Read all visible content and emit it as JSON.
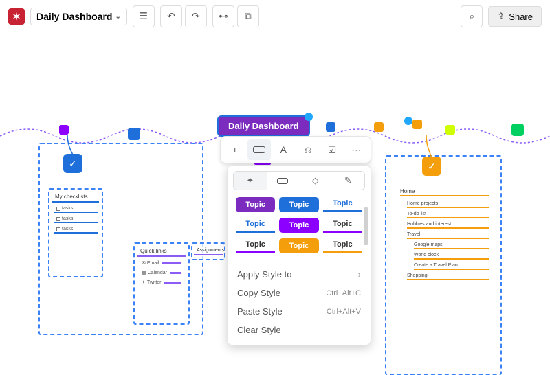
{
  "header": {
    "title": "Daily Dashboard",
    "share_label": "Share"
  },
  "root_node": "Daily Dashboard",
  "checklists": {
    "title": "My checklists",
    "items": [
      "tasks",
      "tasks",
      "tasks"
    ]
  },
  "quick_links": {
    "title": "Quick links",
    "items": [
      "Email",
      "Calendar",
      "Twitter"
    ]
  },
  "assignments": {
    "title": "Assignments"
  },
  "home": {
    "title": "Home",
    "items": [
      {
        "label": "Home projects",
        "sub": []
      },
      {
        "label": "To-do list",
        "sub": []
      },
      {
        "label": "Hobbies and interest",
        "sub": []
      },
      {
        "label": "Travel",
        "sub": [
          "Google maps",
          "World clock",
          "Create a Travel  Plan"
        ]
      },
      {
        "label": "Shopping",
        "sub": []
      }
    ]
  },
  "style_panel": {
    "swatches": [
      "Topic",
      "Topic",
      "Topic",
      "Topic",
      "Topic",
      "Topic",
      "Topic",
      "Topic",
      "Topic"
    ],
    "menu": [
      {
        "label": "Apply Style to",
        "shortcut": "",
        "arrow": true
      },
      {
        "label": "Copy Style",
        "shortcut": "Ctrl+Alt+C"
      },
      {
        "label": "Paste Style",
        "shortcut": "Ctrl+Alt+V"
      },
      {
        "label": "Clear Style",
        "shortcut": ""
      }
    ]
  }
}
